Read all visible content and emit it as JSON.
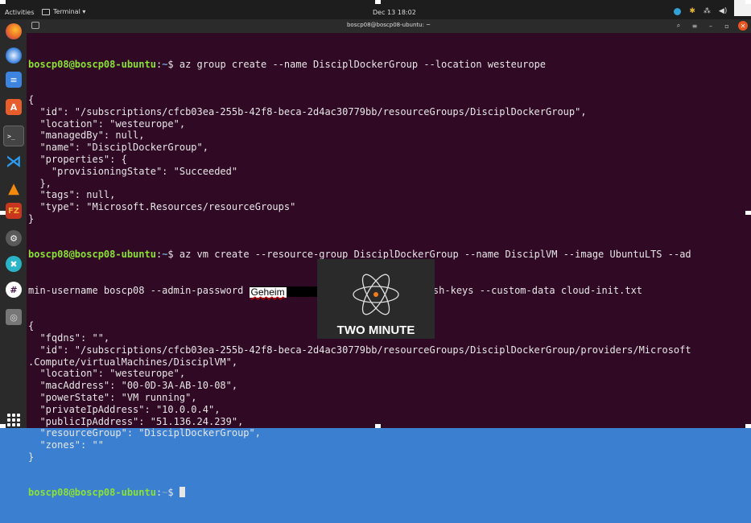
{
  "topbar": {
    "activities": "Activities",
    "terminal_menu": "Terminal ▾",
    "clock": "Dec 13  18:02"
  },
  "window": {
    "title": "boscp08@boscp08-ubuntu: ~"
  },
  "prompt": {
    "user": "boscp08@boscp08-ubuntu",
    "path": "~",
    "symbol": "$"
  },
  "commands": {
    "group_create": " az group create --name DisciplDockerGroup --location westeurope",
    "vm_create_1": " az vm create --resource-group DisciplDockerGroup --name DisciplVM --image UbuntuLTS --ad",
    "vm_create_2a": "min-username boscp08 --admin-password ",
    "vm_create_password": "Geheim",
    "vm_create_2b": "--generate-ssh-keys --custom-data cloud-init.txt"
  },
  "output_group": [
    "{",
    "  \"id\": \"/subscriptions/cfcb03ea-255b-42f8-beca-2d4ac30779bb/resourceGroups/DisciplDockerGroup\",",
    "  \"location\": \"westeurope\",",
    "  \"managedBy\": null,",
    "  \"name\": \"DisciplDockerGroup\",",
    "  \"properties\": {",
    "    \"provisioningState\": \"Succeeded\"",
    "  },",
    "  \"tags\": null,",
    "  \"type\": \"Microsoft.Resources/resourceGroups\"",
    "}"
  ],
  "output_vm": [
    "{",
    "  \"fqdns\": \"\",",
    "  \"id\": \"/subscriptions/cfcb03ea-255b-42f8-beca-2d4ac30779bb/resourceGroups/DisciplDockerGroup/providers/Microsoft",
    ".Compute/virtualMachines/DisciplVM\",",
    "  \"location\": \"westeurope\",",
    "  \"macAddress\": \"00-0D-3A-AB-10-08\",",
    "  \"powerState\": \"VM running\",",
    "  \"privateIpAddress\": \"10.0.0.4\",",
    "  \"publicIpAddress\": \"51.136.24.239\",",
    "  \"resourceGroup\": \"DisciplDockerGroup\",",
    "  \"zones\": \"\"",
    "}"
  ],
  "overlay": {
    "logo_text": "TWO MINUTE"
  },
  "colors": {
    "terminal_bg": "#300a24",
    "prompt_user": "#8ae234",
    "prompt_path": "#729fcf"
  },
  "icons": {
    "dock": [
      "firefox-icon",
      "thunderbird-icon",
      "files-icon",
      "software-icon",
      "terminal-icon",
      "vscode-icon",
      "vlc-icon",
      "filezilla-icon",
      "settings-icon",
      "xmind-icon",
      "slack-icon",
      "disk-icon",
      "show-apps-icon"
    ]
  }
}
